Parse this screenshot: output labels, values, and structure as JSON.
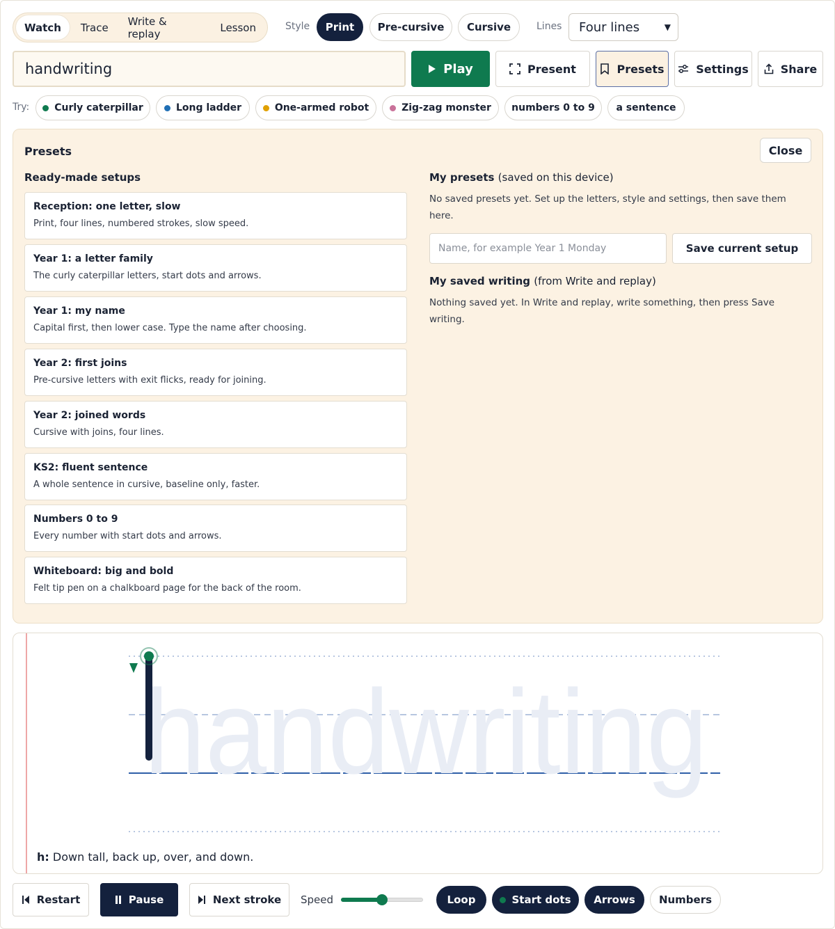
{
  "modes": {
    "tabs": [
      "Watch",
      "Trace",
      "Write & replay",
      "Lesson"
    ],
    "active": "Watch"
  },
  "style": {
    "label": "Style",
    "options": [
      "Print",
      "Pre-cursive",
      "Cursive"
    ],
    "selected": "Print"
  },
  "lines": {
    "label": "Lines",
    "value": "Four lines"
  },
  "input": {
    "value": "handwriting"
  },
  "actions": {
    "play": "Play",
    "present": "Present",
    "presets": "Presets",
    "settings": "Settings",
    "share": "Share"
  },
  "try": {
    "label": "Try:",
    "chips": [
      {
        "label": "Curly caterpillar",
        "color": "#0f7a4f"
      },
      {
        "label": "Long ladder",
        "color": "#1f6fb5"
      },
      {
        "label": "One-armed robot",
        "color": "#e0a000"
      },
      {
        "label": "Zig-zag monster",
        "color": "#c9729a"
      },
      {
        "label": "numbers 0 to 9",
        "color": ""
      },
      {
        "label": "a sentence",
        "color": ""
      }
    ]
  },
  "presets_panel": {
    "title": "Presets",
    "close": "Close",
    "ready_made_heading": "Ready-made setups",
    "ready_made": [
      {
        "title": "Reception: one letter, slow",
        "desc": "Print, four lines, numbered strokes, slow speed."
      },
      {
        "title": "Year 1: a letter family",
        "desc": "The curly caterpillar letters, start dots and arrows."
      },
      {
        "title": "Year 1: my name",
        "desc": "Capital first, then lower case. Type the name after choosing."
      },
      {
        "title": "Year 2: first joins",
        "desc": "Pre-cursive letters with exit flicks, ready for joining."
      },
      {
        "title": "Year 2: joined words",
        "desc": "Cursive with joins, four lines."
      },
      {
        "title": "KS2: fluent sentence",
        "desc": "A whole sentence in cursive, baseline only, faster."
      },
      {
        "title": "Numbers 0 to 9",
        "desc": "Every number with start dots and arrows."
      },
      {
        "title": "Whiteboard: big and bold",
        "desc": "Felt tip pen on a chalkboard page for the back of the room."
      }
    ],
    "my_presets": {
      "heading": "My presets",
      "heading_note": "(saved on this device)",
      "empty_text": "No saved presets yet. Set up the letters, style and settings, then save them here.",
      "name_placeholder": "Name, for example Year 1 Monday",
      "save_button": "Save current setup"
    },
    "my_writing": {
      "heading": "My saved writing",
      "heading_note": "(from Write and replay)",
      "empty_text": "Nothing saved yet. In Write and replay, write something, then press Save writing."
    }
  },
  "canvas": {
    "word": "handwriting",
    "hint_letter": "h:",
    "hint_text": "Down tall, back up, over, and down.",
    "accent": "#0f7a4f",
    "ink": "#14213d",
    "margin_color": "#e88a8a",
    "baseline_color": "#2f5fa8"
  },
  "controls": {
    "restart": "Restart",
    "pause": "Pause",
    "next_stroke": "Next stroke",
    "speed_label": "Speed",
    "speed_fraction": 0.5,
    "toggles": [
      {
        "label": "Loop",
        "on": true
      },
      {
        "label": "Start dots",
        "on": true
      },
      {
        "label": "Arrows",
        "on": true
      },
      {
        "label": "Numbers",
        "on": false
      }
    ]
  }
}
